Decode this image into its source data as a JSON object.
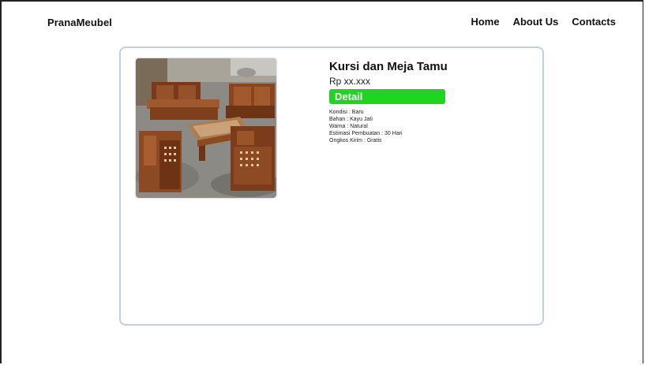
{
  "header": {
    "brand": "PranaMeubel",
    "nav": [
      {
        "label": "Home"
      },
      {
        "label": "About Us"
      },
      {
        "label": "Contacts"
      }
    ]
  },
  "product": {
    "image_icon": "furniture-photo",
    "title": "Kursi dan Meja Tamu",
    "price": "Rp xx.xxx",
    "detail_label": "Detail",
    "specs": [
      "Kondisi : Baru",
      "Bahan : Kayu Jati",
      "Warna : Natural",
      "Estimasi Pembuatan : 30 Hari",
      "Ongkos Kirim : Gratis"
    ]
  },
  "colors": {
    "accent_green": "#21d421",
    "card_border": "#bfd1e5"
  }
}
